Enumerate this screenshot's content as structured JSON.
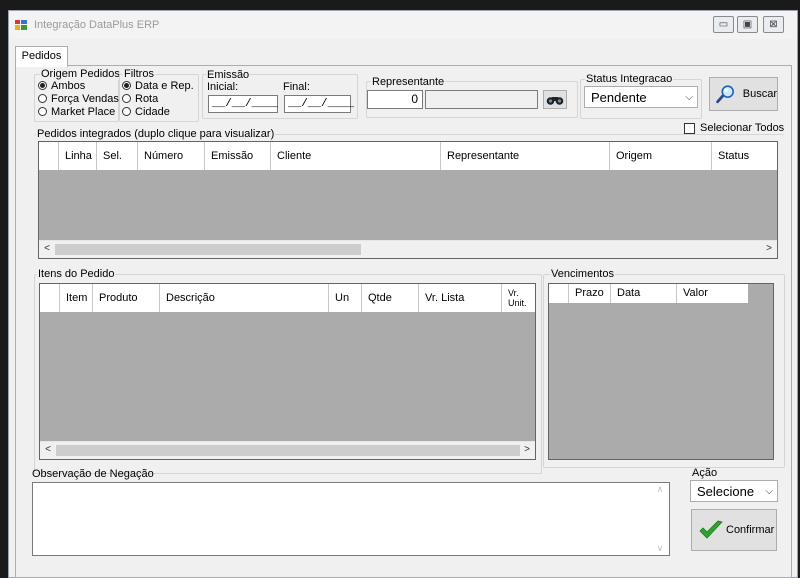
{
  "window": {
    "title": "Integração DataPlus ERP",
    "buttons": {
      "minimize": "▭",
      "maximize": "▣",
      "close": "⊠"
    }
  },
  "tab": {
    "label": "Pedidos"
  },
  "origem": {
    "title": "Origem Pedidos",
    "options": [
      {
        "label": "Ambos",
        "selected": true
      },
      {
        "label": "Força Vendas",
        "selected": false
      },
      {
        "label": "Market Place",
        "selected": false
      }
    ]
  },
  "filtros": {
    "title": "Filtros",
    "options": [
      {
        "label": "Data e Rep.",
        "selected": true
      },
      {
        "label": "Rota",
        "selected": false
      },
      {
        "label": "Cidade",
        "selected": false
      }
    ]
  },
  "emissao": {
    "title": "Emissão",
    "inicial_label": "Inicial:",
    "final_label": "Final:",
    "inicial_value": "__/__/____",
    "final_value": "__/__/____"
  },
  "representante": {
    "title": "Representante",
    "code": "0",
    "name": ""
  },
  "status": {
    "title": "Status Integracao",
    "selected": "Pendente"
  },
  "buscar": {
    "label": "Buscar"
  },
  "selecionar_todos": {
    "label": "Selecionar Todos",
    "checked": false
  },
  "pedidos": {
    "title": "Pedidos integrados (duplo clique para visualizar)",
    "columns": [
      "Linha",
      "Sel.",
      "Número",
      "Emissão",
      "Cliente",
      "Representante",
      "Origem",
      "Status"
    ]
  },
  "itens": {
    "title": "Itens do Pedido",
    "columns": [
      "Item",
      "Produto",
      "Descrição",
      "Un",
      "Qtde",
      "Vr. Lista",
      "Vr. Unit."
    ]
  },
  "vencimentos": {
    "title": "Vencimentos",
    "columns": [
      "Prazo",
      "Data",
      "Valor"
    ]
  },
  "observacao": {
    "label": "Observação de Negação",
    "value": ""
  },
  "acao": {
    "label": "Ação",
    "selected": "Selecione"
  },
  "confirmar": {
    "label": "Confirmar"
  },
  "colors": {
    "accent": "#1e5fb4",
    "grid_bg": "#ababab",
    "check_green": "#2ea52e"
  }
}
